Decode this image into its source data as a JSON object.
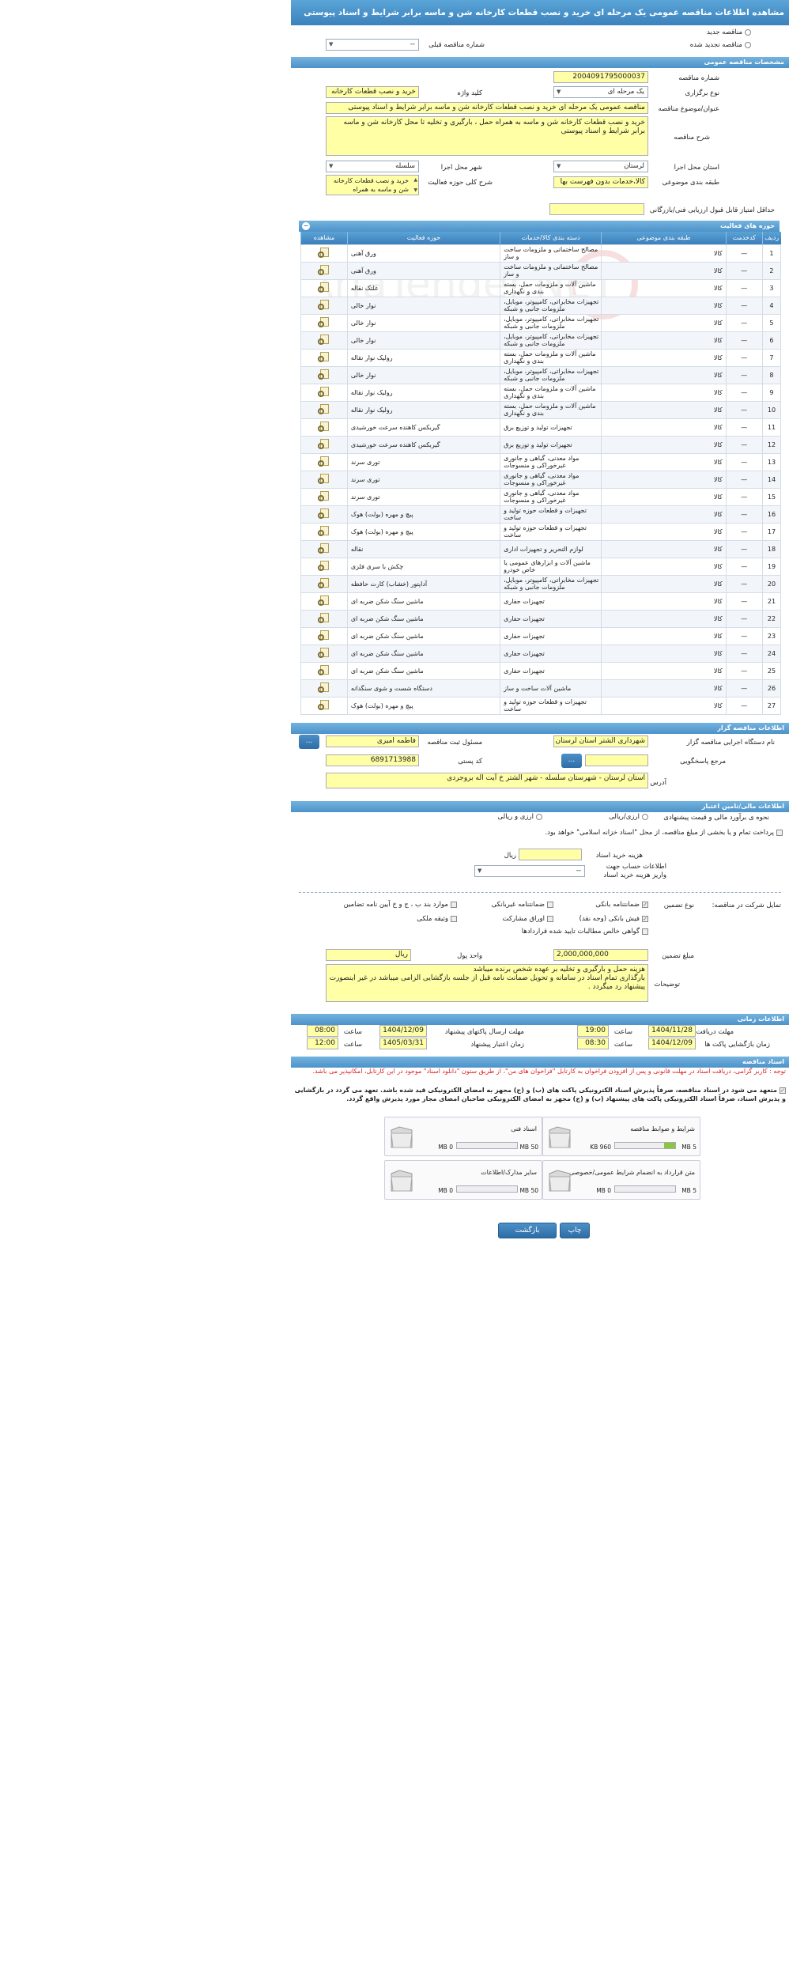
{
  "title": "مشاهده اطلاعات مناقصه عمومی یک مرحله ای خرید و نصب قطعات کارخانه شن و ماسه برابر شرایط و اسناد پیوستی",
  "top": {
    "new_label": "مناقصه جدید",
    "renewed_label": "مناقصه تجدید شده",
    "prev_number_label": "شماره مناقصه قبلی",
    "prev_number_value": "--"
  },
  "general": {
    "section": "مشخصات مناقصه عمومی",
    "number_label": "شماره مناقصه",
    "number": "2004091795000037",
    "type_label": "نوع برگزاری",
    "type": "یک مرحله ای",
    "keyword_label": "کلید واژه",
    "keyword": "خرید و نصب قطعات کارخانه",
    "subject_label": "عنوان/موضوع مناقصه",
    "subject": "مناقصه عمومی یک مرحله ای خرید و نصب قطعات کارخانه شن و ماسه برابر شرایط و اسناد پیوستی",
    "desc_label": "شرح مناقصه",
    "desc": "خرید و نصب قطعات کارخانه شن و ماسه به همراه حمل ، بارگیری و تخلیه تا محل کارخانه شن و ماسه برابر شرایط و اسناد پیوستی",
    "province_label": "استان محل اجرا",
    "province": "لرستان",
    "city_label": "شهر محل اجرا",
    "city": "سلسله",
    "category_label": "طبقه بندی موضوعی",
    "category": "کالا،خدمات بدون فهرست بها",
    "scope_label": "شرح کلی حوزه فعالیت",
    "scope": "خرید و نصب قطعات کارخانه شن و ماسه به همراه",
    "min_score_label": "حداقل امتیاز قابل قبول ارزیابی فنی/بازرگانی",
    "min_score": ""
  },
  "activities": {
    "section": "حوزه های فعالیت",
    "headers": [
      "ردیف",
      "کدخدمت",
      "طبقه بندی موضوعی",
      "دسته بندی کالا/خدمات",
      "حوزه فعالیت",
      "مشاهده"
    ],
    "rows": [
      [
        "1",
        "—",
        "کالا",
        "مصالح ساختمانی و ملزومات ساخت و ساز",
        "ورق آهنی"
      ],
      [
        "2",
        "—",
        "کالا",
        "مصالح ساختمانی و ملزومات ساخت و ساز",
        "ورق آهنی"
      ],
      [
        "3",
        "—",
        "کالا",
        "ماشین آلات و ملزومات حمل، بسته بندی و نگهداری",
        "غلتک نقاله"
      ],
      [
        "4",
        "—",
        "کالا",
        "تجهیزات مخابراتی، کامپیوتر، موبایل، ملزومات جانبی و شبکه",
        "نوار خالی"
      ],
      [
        "5",
        "—",
        "کالا",
        "تجهیزات مخابراتی، کامپیوتر، موبایل، ملزومات جانبی و شبکه",
        "نوار خالی"
      ],
      [
        "6",
        "—",
        "کالا",
        "تجهیزات مخابراتی، کامپیوتر، موبایل، ملزومات جانبی و شبکه",
        "نوار خالی"
      ],
      [
        "7",
        "—",
        "کالا",
        "ماشین آلات و ملزومات حمل، بسته بندی و نگهداری",
        "رولیک نوار نقاله"
      ],
      [
        "8",
        "—",
        "کالا",
        "تجهیزات مخابراتی، کامپیوتر، موبایل، ملزومات جانبی و شبکه",
        "نوار خالی"
      ],
      [
        "9",
        "—",
        "کالا",
        "ماشین آلات و ملزومات حمل، بسته بندی و نگهداری",
        "رولیک نوار نقاله"
      ],
      [
        "10",
        "—",
        "کالا",
        "ماشین آلات و ملزومات حمل، بسته بندی و نگهداری",
        "رولیک نوار نقاله"
      ],
      [
        "11",
        "—",
        "کالا",
        "تجهیزات تولید و توزیع برق",
        "گیربکس کاهنده سرعت خورشیدی"
      ],
      [
        "12",
        "—",
        "کالا",
        "تجهیزات تولید و توزیع برق",
        "گیربکس کاهنده سرعت خورشیدی"
      ],
      [
        "13",
        "—",
        "کالا",
        "مواد معدنی، گیاهی و جانوری غیرخوراکی و منسوجات",
        "توری سرند"
      ],
      [
        "14",
        "—",
        "کالا",
        "مواد معدنی، گیاهی و جانوری غیرخوراکی و منسوجات",
        "توری سرند"
      ],
      [
        "15",
        "—",
        "کالا",
        "مواد معدنی، گیاهی و جانوری غیرخوراکی و منسوجات",
        "توری سرند"
      ],
      [
        "16",
        "—",
        "کالا",
        "تجهیزات و قطعات حوزه تولید و ساخت",
        "پیچ و مهره (بولت) هوک"
      ],
      [
        "17",
        "—",
        "کالا",
        "تجهیزات و قطعات حوزه تولید و ساخت",
        "پیچ و مهره (بولت) هوک"
      ],
      [
        "18",
        "—",
        "کالا",
        "لوازم التحریر و تجهیزات اداری",
        "نقاله"
      ],
      [
        "19",
        "—",
        "کالا",
        "ماشین آلات و ابزارهای عمومی یا خاص خودرو",
        "چکش با سری فلزی"
      ],
      [
        "20",
        "—",
        "کالا",
        "تجهیزات مخابراتی، کامپیوتر، موبایل، ملزومات جانبی و شبکه",
        "آداپتور (خشاب) کارت حافظه"
      ],
      [
        "21",
        "—",
        "کالا",
        "تجهیزات حفاری",
        "ماشین سنگ شکن ضربه ای"
      ],
      [
        "22",
        "—",
        "کالا",
        "تجهیزات حفاری",
        "ماشین سنگ شکن ضربه ای"
      ],
      [
        "23",
        "—",
        "کالا",
        "تجهیزات حفاری",
        "ماشین سنگ شکن ضربه ای"
      ],
      [
        "24",
        "—",
        "کالا",
        "تجهیزات حفاری",
        "ماشین سنگ شکن ضربه ای"
      ],
      [
        "25",
        "—",
        "کالا",
        "تجهیزات حفاری",
        "ماشین سنگ شکن ضربه ای"
      ],
      [
        "26",
        "—",
        "کالا",
        "ماشین آلات ساخت و ساز",
        "دستگاه شست و شوی سنگدانه"
      ],
      [
        "27",
        "—",
        "کالا",
        "تجهیزات و قطعات حوزه تولید و ساخت",
        "پیچ و مهره (بولت) هوک"
      ]
    ]
  },
  "organizer": {
    "section": "اطلاعات مناقصه گزار",
    "org_label": "نام دستگاه اجرایی مناقصه گزار",
    "org": "شهرداری الشتر استان لرستان",
    "resp_label": "مسئول ثبت مناقصه",
    "resp": "فاطمه امیری",
    "ref_label": "مرجع پاسخگویی",
    "ref": "",
    "postal_label": "کد پستی",
    "postal": "6891713988",
    "address_label": "آدرس",
    "address": "استان لرستان - شهرستان سلسله - شهر الشتر  خ آیت اله بروجردی",
    "dots": "..."
  },
  "finance": {
    "section": "اطلاعات مالی/تامین اعتبار",
    "estimate_label": "نحوه ی برآورد مالی و قیمت پیشنهادی",
    "opt1": "ارزی/ریالی",
    "opt2": "ارزی و ریالی",
    "treasury_text": "پرداخت تمام و یا بخشی از مبلغ مناقصه، از محل \"اسناد خزانه اسلامی\" خواهد بود.",
    "doc_cost_label": "هزینه خرید اسناد",
    "doc_cost": "",
    "rial": "ریال",
    "account_label": "اطلاعات حساب جهت واریز هزینه خرید اسناد",
    "account": "--",
    "guarantee_label": "تمایل شرکت در مناقصه:",
    "guarantee_type_label": "نوع تضمین",
    "g1": "ضمانتنامه بانکی",
    "g2": "ضمانتنامه غیربانکی",
    "g3": "موارد بند ب ، ج و خ آیین نامه تضامین",
    "g4": "فیش بانکی (وجه نقد)",
    "g5": "اوراق مشارکت",
    "g6": "وثیقه ملکی",
    "g7": "گواهی خالص مطالبات تایید شده قراردادها",
    "amount_label": "مبلغ تضمین",
    "amount": "2,000,000,000",
    "unit_label": "واحد پول",
    "unit": "ریال",
    "notes_label": "توضیحات",
    "notes": "هزینه حمل و بارگیری و تخلیه بر عهده شخص برنده میباشد\nبارگذاری تمام اسناد در سامانه و تحویل ضمانت نامه قبل از جلسه بازگشایی الزامی میباشد در غیر اینصورت پیشنهاد رد میگردد ."
  },
  "timing": {
    "section": "اطلاعات زمانی",
    "receive_label": "مهلت دریافت اسناد",
    "receive_date": "1404/11/28",
    "receive_time": "19:00",
    "send_label": "مهلت ارسال پاکتهای پیشنهاد",
    "send_date": "1404/12/09",
    "send_time": "08:00",
    "open_label": "زمان بازگشایی پاکت ها",
    "open_date": "1404/12/09",
    "open_time": "08:30",
    "valid_label": "زمان اعتبار پیشنهاد",
    "valid_date": "1405/03/31",
    "valid_time": "12:00",
    "time_label": "ساعت"
  },
  "docs": {
    "section": "اسناد مناقصه",
    "note": "توجه : کاربر گرامی، دریافت اسناد در مهلت قانونی و پس از افزودن فراخوان به کارتابل \"فراخوان های من\"، از طریق ستون \"دانلود اسناد\" موجود در این کارتابل، امکانپذیر می باشد.",
    "commit": "متعهد می شود در اسناد مناقصه، صرفاً پذیرش اسناد الکترونیکی پاکت های (ب) و (ج) مجهز به امضای الکترونیکی قید شده باشد. تعهد می گردد در بازگشایی و پذیرش اسناد، صرفاً اسناد الکترونیکی پاکت های پیشنهاد (ب) و (ج) مجهز به امضای الکترونیکی صاحبان امضای مجاز مورد پذیرش واقع گردد.",
    "items": [
      {
        "title": "شرایط و ضوابط مناقصه",
        "used": "960 KB",
        "max": "5 MB",
        "fill": 0.19
      },
      {
        "title": "اسناد فنی",
        "used": "0 MB",
        "max": "50 MB",
        "fill": 0
      },
      {
        "title": "متن قرارداد به انضمام شرایط عمومی/خصوصی",
        "used": "0 MB",
        "max": "5 MB",
        "fill": 0
      },
      {
        "title": "سایر مدارک/اطلاعات",
        "used": "0 MB",
        "max": "50 MB",
        "fill": 0
      }
    ]
  },
  "buttons": {
    "print": "چاپ",
    "back": "بازگشت"
  },
  "watermark": "AriaTender.NET"
}
